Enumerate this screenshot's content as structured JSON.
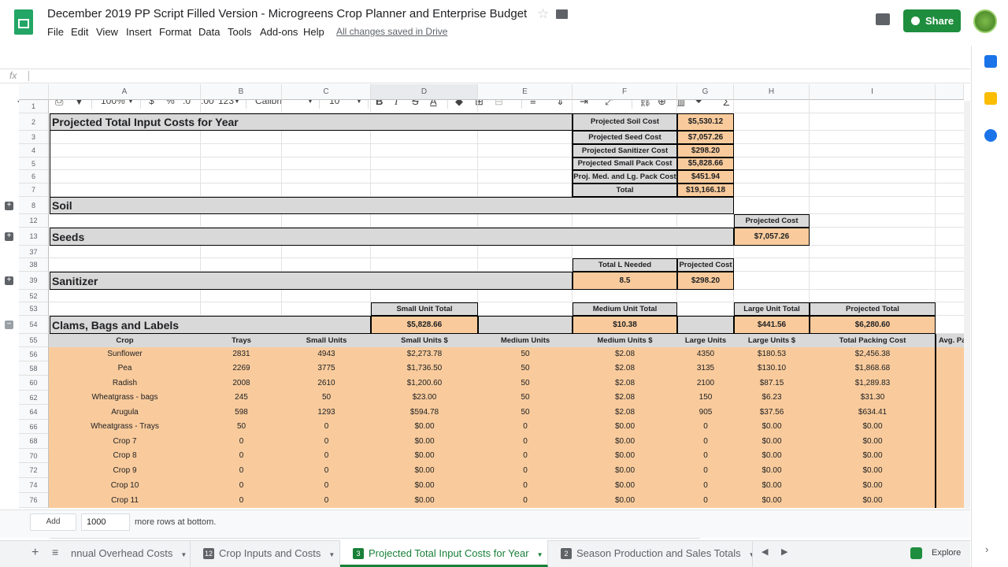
{
  "app": {
    "doc_title": "December 2019 PP Script Filled Version - Microgreens Crop Planner and Enterprise Budget",
    "menus": [
      "File",
      "Edit",
      "View",
      "Insert",
      "Format",
      "Data",
      "Tools",
      "Add-ons",
      "Help"
    ],
    "saved_status": "All changes saved in Drive",
    "share_label": "Share",
    "formula_label": "fx"
  },
  "toolbar": {
    "zoom": "100%",
    "currency": "$",
    "percent": "%",
    "dec_less": ".0",
    "dec_more": ".00",
    "format": "123",
    "font": "Calibri",
    "size": "10"
  },
  "columns": [
    "A",
    "B",
    "C",
    "D",
    "E",
    "F",
    "G",
    "H",
    "I"
  ],
  "rows": [
    "1",
    "2",
    "3",
    "4",
    "5",
    "6",
    "7",
    "8",
    "12",
    "13",
    "37",
    "38",
    "39",
    "52",
    "53",
    "54",
    "55",
    "56",
    "58",
    "60",
    "62",
    "64",
    "66",
    "68",
    "70",
    "72",
    "74",
    "76"
  ],
  "summary": {
    "title": "Projected Total Input Costs for Year",
    "items": [
      {
        "label": "Projected Soil Cost",
        "value": "$5,530.12"
      },
      {
        "label": "Projected Seed Cost",
        "value": "$7,057.26"
      },
      {
        "label": "Projected Sanitizer Cost",
        "value": "$298.20"
      },
      {
        "label": "Projected Small Pack Cost",
        "value": "$5,828.66"
      },
      {
        "label": "Proj. Med. and Lg. Pack Cost",
        "value": "$451.94"
      },
      {
        "label": "Total",
        "value": "$19,166.18"
      }
    ]
  },
  "sections": {
    "soil": "Soil",
    "seeds": "Seeds",
    "seeds_cost_label": "Projected Cost",
    "seeds_cost": "$7,057.26",
    "sanitizer": "Sanitizer",
    "san_l_label": "Total L Needed",
    "san_l_value": "8.5",
    "san_cost_label": "Projected Cost",
    "san_cost": "$298.20",
    "clams": "Clams, Bags and Labels",
    "small_total_label": "Small Unit Total",
    "small_total": "$5,828.66",
    "medium_total_label": "Medium Unit Total",
    "medium_total": "$10.38",
    "large_total_label": "Large Unit Total",
    "large_total": "$441.56",
    "projected_total_label": "Projected Total",
    "projected_total": "$6,280.60"
  },
  "table": {
    "headers": [
      "Crop",
      "Trays",
      "Small Units",
      "Small Units $",
      "Medium Units",
      "Medium Units $",
      "Large Units",
      "Large Units $",
      "Total Packing Cost",
      "Avg. Pa"
    ],
    "rows": [
      [
        "Sunflower",
        "2831",
        "4943",
        "$2,273.78",
        "50",
        "$2.08",
        "4350",
        "$180.53",
        "$2,456.38"
      ],
      [
        "Pea",
        "2269",
        "3775",
        "$1,736.50",
        "50",
        "$2.08",
        "3135",
        "$130.10",
        "$1,868.68"
      ],
      [
        "Radish",
        "2008",
        "2610",
        "$1,200.60",
        "50",
        "$2.08",
        "2100",
        "$87.15",
        "$1,289.83"
      ],
      [
        "Wheatgrass - bags",
        "245",
        "50",
        "$23.00",
        "50",
        "$2.08",
        "150",
        "$6.23",
        "$31.30"
      ],
      [
        "Arugula",
        "598",
        "1293",
        "$594.78",
        "50",
        "$2.08",
        "905",
        "$37.56",
        "$634.41"
      ],
      [
        "Wheatgrass - Trays",
        "50",
        "0",
        "$0.00",
        "0",
        "$0.00",
        "0",
        "$0.00",
        "$0.00"
      ],
      [
        "Crop 7",
        "0",
        "0",
        "$0.00",
        "0",
        "$0.00",
        "0",
        "$0.00",
        "$0.00"
      ],
      [
        "Crop 8",
        "0",
        "0",
        "$0.00",
        "0",
        "$0.00",
        "0",
        "$0.00",
        "$0.00"
      ],
      [
        "Crop 9",
        "0",
        "0",
        "$0.00",
        "0",
        "$0.00",
        "0",
        "$0.00",
        "$0.00"
      ],
      [
        "Crop 10",
        "0",
        "0",
        "$0.00",
        "0",
        "$0.00",
        "0",
        "$0.00",
        "$0.00"
      ],
      [
        "Crop 11",
        "0",
        "0",
        "$0.00",
        "0",
        "$0.00",
        "0",
        "$0.00",
        "$0.00"
      ]
    ]
  },
  "bottom": {
    "add_label": "Add",
    "rows_value": "1000",
    "more_rows": "more rows at bottom."
  },
  "tabs": [
    {
      "label": "nnual Overhead Costs",
      "num": ""
    },
    {
      "label": "Crop Inputs and Costs",
      "num": "12"
    },
    {
      "label": "Projected Total Input Costs for Year",
      "num": "3"
    },
    {
      "label": "Season Production and Sales Totals",
      "num": "2"
    }
  ],
  "explore_label": "Explore",
  "colors": {
    "peach": "#f9cb9c",
    "gray": "#d9d9d9",
    "green": "#188038"
  }
}
